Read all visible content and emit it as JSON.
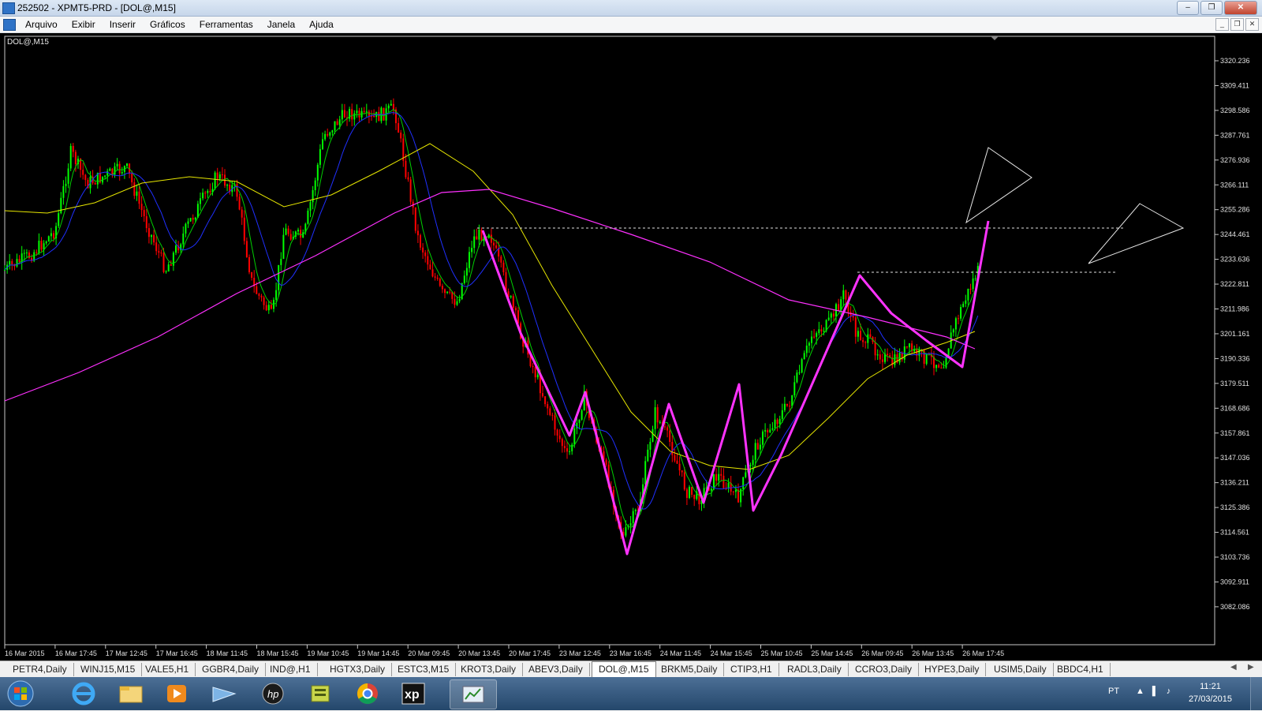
{
  "window": {
    "title": "252502 - XPMT5-PRD - [DOL@,M15]"
  },
  "menu": [
    "Arquivo",
    "Exibir",
    "Inserir",
    "Gráficos",
    "Ferramentas",
    "Janela",
    "Ajuda"
  ],
  "chart": {
    "label": "DOL@,M15",
    "price_labels": [
      "3320.236",
      "3309.411",
      "3298.586",
      "3287.761",
      "3276.936",
      "3266.111",
      "3255.286",
      "3244.461",
      "3233.636",
      "3222.811",
      "3211.986",
      "3201.161",
      "3190.336",
      "3179.511",
      "3168.686",
      "3157.861",
      "3147.036",
      "3136.211",
      "3125.386",
      "3114.561",
      "3103.736",
      "3092.911",
      "3082.086"
    ],
    "time_labels": [
      "16 Mar 2015",
      "16 Mar 17:45",
      "17 Mar 12:45",
      "17 Mar 16:45",
      "18 Mar 11:45",
      "18 Mar 15:45",
      "19 Mar 10:45",
      "19 Mar 14:45",
      "20 Mar 09:45",
      "20 Mar 13:45",
      "20 Mar 17:45",
      "23 Mar 12:45",
      "23 Mar 16:45",
      "24 Mar 11:45",
      "24 Mar 15:45",
      "25 Mar 10:45",
      "25 Mar 14:45",
      "26 Mar 09:45",
      "26 Mar 13:45",
      "26 Mar 17:45"
    ],
    "colors": {
      "bull": "#00ff00",
      "bear": "#ff0000",
      "ma_fast": "#00d000",
      "ma_mid": "#2030ff",
      "ma_slow": "#e6e600",
      "ma_long": "#ff30ff",
      "zigzag": "#ff33ff"
    }
  },
  "tabs": {
    "items": [
      "PETR4,Daily",
      "WINJ15,M15",
      "VALE5,H1",
      "GGBR4,Daily",
      "IND@,H1",
      "HGTX3,Daily",
      "ESTC3,M15",
      "KROT3,Daily",
      "ABEV3,Daily",
      "DOL@,M15",
      "BRKM5,Daily",
      "CTIP3,H1",
      "RADL3,Daily",
      "CCRO3,Daily",
      "HYPE3,Daily",
      "USIM5,Daily",
      "BBDC4,H1"
    ],
    "active": "DOL@,M15"
  },
  "taskbar": {
    "language": "PT",
    "time": "11:21",
    "date": "27/03/2015"
  }
}
